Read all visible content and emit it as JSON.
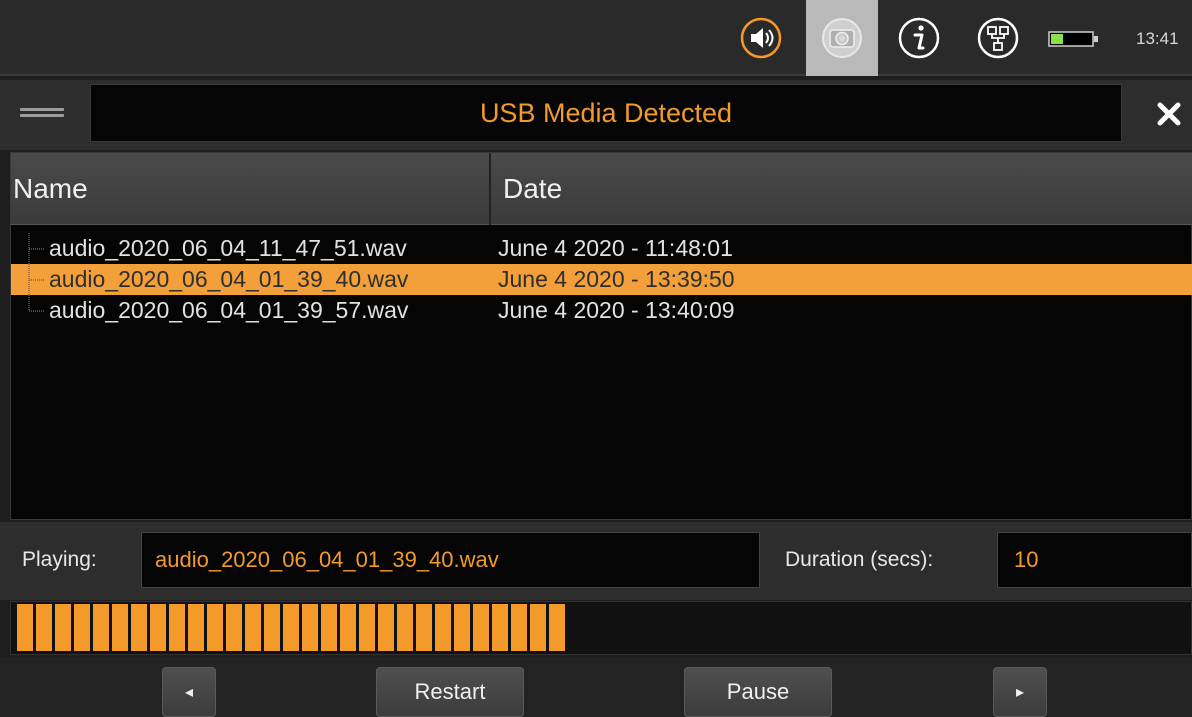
{
  "status_bar": {
    "icons": [
      "speaker-icon",
      "camera-icon",
      "info-icon",
      "network-icon",
      "battery-icon"
    ],
    "time": "13:41",
    "accent_color": "#f39a2b",
    "battery_level": 0.3
  },
  "dialog": {
    "title": "USB Media Detected",
    "close_label": "✕"
  },
  "table": {
    "columns": [
      "Name",
      "Date"
    ],
    "rows": [
      {
        "name": "audio_2020_06_04_11_47_51.wav",
        "date": "June 4 2020 - 11:48:01",
        "selected": false
      },
      {
        "name": "audio_2020_06_04_01_39_40.wav",
        "date": "June 4 2020 - 13:39:50",
        "selected": true
      },
      {
        "name": "audio_2020_06_04_01_39_57.wav",
        "date": "June 4 2020 - 13:40:09",
        "selected": false
      }
    ]
  },
  "player": {
    "playing_label": "Playing:",
    "playing_value": "audio_2020_06_04_01_39_40.wav",
    "duration_label": "Duration (secs):",
    "duration_value": "10",
    "progress_fraction": 0.48
  },
  "nav": {
    "prev_icon": "◂",
    "restart_label": "Restart",
    "pause_label": "Pause",
    "next_icon": "▸"
  }
}
